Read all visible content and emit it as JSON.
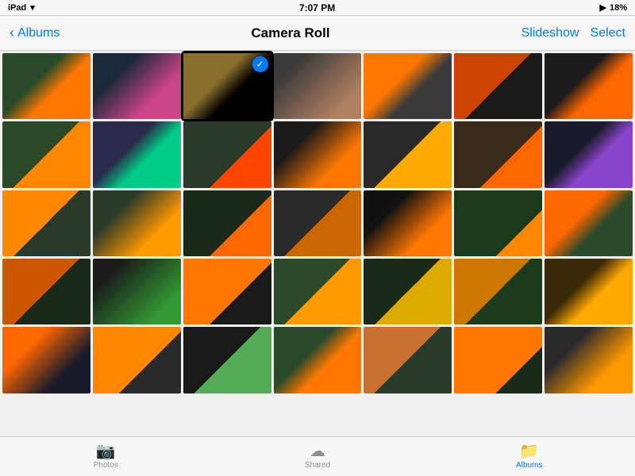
{
  "statusBar": {
    "carrier": "iPad",
    "wifi": "WiFi",
    "time": "7:07 PM",
    "signal": "▶",
    "battery": "18%"
  },
  "navBar": {
    "backLabel": "Albums",
    "title": "Camera Roll",
    "slideshowLabel": "Slideshow",
    "selectLabel": "Select"
  },
  "photos": {
    "selected": 2,
    "rows": [
      [
        {
          "id": 0,
          "palette": "p0",
          "selected": false
        },
        {
          "id": 1,
          "palette": "p1",
          "selected": false
        },
        {
          "id": 2,
          "palette": "p2",
          "selected": true
        },
        {
          "id": 3,
          "palette": "p3",
          "selected": false
        },
        {
          "id": 4,
          "palette": "p4",
          "selected": false
        },
        {
          "id": 5,
          "palette": "p5",
          "selected": false
        },
        {
          "id": 6,
          "palette": "p6",
          "selected": false
        }
      ],
      [
        {
          "id": 7,
          "palette": "p7",
          "selected": false
        },
        {
          "id": 8,
          "palette": "p8",
          "selected": false
        },
        {
          "id": 9,
          "palette": "p9",
          "selected": false
        },
        {
          "id": 10,
          "palette": "p10",
          "selected": false
        },
        {
          "id": 11,
          "palette": "p11",
          "selected": false
        },
        {
          "id": 12,
          "palette": "p12",
          "selected": false
        },
        {
          "id": 13,
          "palette": "p13",
          "selected": false
        }
      ],
      [
        {
          "id": 14,
          "palette": "p14",
          "selected": false
        },
        {
          "id": 15,
          "palette": "p15",
          "selected": false
        },
        {
          "id": 16,
          "palette": "p16",
          "selected": false
        },
        {
          "id": 17,
          "palette": "p17",
          "selected": false
        },
        {
          "id": 18,
          "palette": "p18",
          "selected": false
        },
        {
          "id": 19,
          "palette": "p19",
          "selected": false
        },
        {
          "id": 20,
          "palette": "p20",
          "selected": false
        }
      ],
      [
        {
          "id": 21,
          "palette": "p21",
          "selected": false
        },
        {
          "id": 22,
          "palette": "p22",
          "selected": false
        },
        {
          "id": 23,
          "palette": "p23",
          "selected": false
        },
        {
          "id": 24,
          "palette": "p24",
          "selected": false
        },
        {
          "id": 25,
          "palette": "p25",
          "selected": false
        },
        {
          "id": 26,
          "palette": "p26",
          "selected": false
        },
        {
          "id": 27,
          "palette": "p27",
          "selected": false
        }
      ],
      [
        {
          "id": 28,
          "palette": "p28",
          "selected": false
        },
        {
          "id": 29,
          "palette": "p29",
          "selected": false
        },
        {
          "id": 30,
          "palette": "p30",
          "selected": false
        },
        {
          "id": 31,
          "palette": "p31",
          "selected": false
        },
        {
          "id": 32,
          "palette": "p32",
          "selected": false
        },
        {
          "id": 33,
          "palette": "p33",
          "selected": false
        },
        {
          "id": 34,
          "palette": "p34",
          "selected": false
        }
      ]
    ]
  },
  "tabBar": {
    "tabs": [
      {
        "id": "photos",
        "label": "Photos",
        "icon": "📷",
        "active": false
      },
      {
        "id": "shared",
        "label": "Shared",
        "icon": "☁",
        "active": false
      },
      {
        "id": "albums",
        "label": "Albums",
        "icon": "📁",
        "active": true
      }
    ]
  }
}
